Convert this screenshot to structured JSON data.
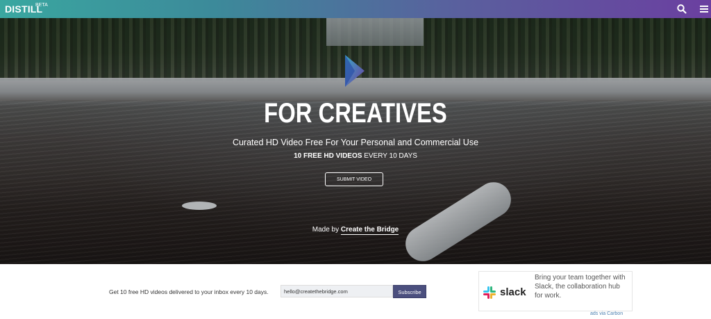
{
  "header": {
    "logo": "DISTILL",
    "badge": "BETA",
    "search_icon": "search-icon",
    "menu_icon": "hamburger-menu-icon"
  },
  "hero": {
    "title": "FOR CREATIVES",
    "subtitle": "Curated HD Video Free For Your Personal and Commercial Use",
    "tagline_bold": "10 FREE HD VIDEOS",
    "tagline_rest": " EVERY 10 DAYS",
    "submit_label": "SUBMIT VIDEO",
    "made_by_prefix": "Made by ",
    "made_by_link": "Create the Bridge"
  },
  "newsletter": {
    "text": "Get 10 free HD videos delivered to your inbox every 10 days.",
    "email_value": "hello@createthebridge.com",
    "subscribe_label": "Subscribe"
  },
  "ad": {
    "brand": "slack",
    "text": "Bring your team together with Slack, the collaboration hub for work.",
    "credit": "ads via Carbon"
  },
  "colors": {
    "header_gradient_start": "#3aa7a0",
    "header_gradient_end": "#6b3fa0",
    "subscribe_bg": "#4b4f7e",
    "credit_link": "#4a7fb0"
  }
}
